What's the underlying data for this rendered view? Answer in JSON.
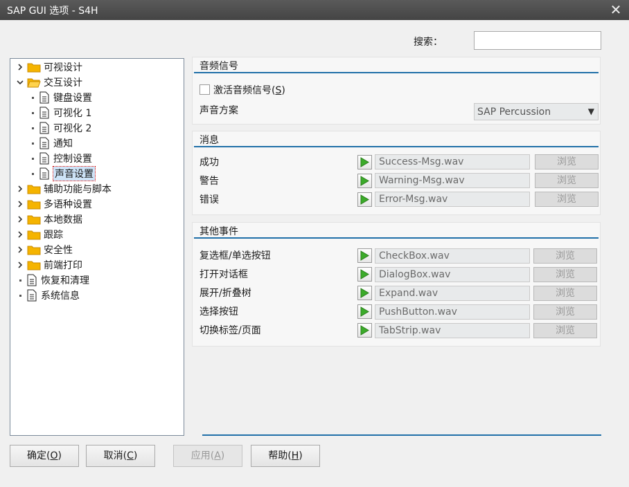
{
  "window": {
    "title": "SAP GUI 选项 - S4H",
    "close_icon": "close-icon"
  },
  "search": {
    "label": "搜索：",
    "value": ""
  },
  "tree": {
    "items": [
      {
        "label": "可视设计",
        "type": "folder",
        "expanded": false
      },
      {
        "label": "交互设计",
        "type": "folder",
        "expanded": true
      },
      {
        "label": "键盘设置",
        "type": "doc"
      },
      {
        "label": "可视化 1",
        "type": "doc"
      },
      {
        "label": "可视化 2",
        "type": "doc"
      },
      {
        "label": "通知",
        "type": "doc"
      },
      {
        "label": "控制设置",
        "type": "doc"
      },
      {
        "label": "声音设置",
        "type": "doc",
        "selected": true
      },
      {
        "label": "辅助功能与脚本",
        "type": "folder",
        "expanded": false
      },
      {
        "label": "多语种设置",
        "type": "folder",
        "expanded": false
      },
      {
        "label": "本地数据",
        "type": "folder",
        "expanded": false
      },
      {
        "label": "跟踪",
        "type": "folder",
        "expanded": false
      },
      {
        "label": "安全性",
        "type": "folder",
        "expanded": false
      },
      {
        "label": "前端打印",
        "type": "folder",
        "expanded": false
      },
      {
        "label": "恢复和清理",
        "type": "doc"
      },
      {
        "label": "系统信息",
        "type": "doc"
      }
    ]
  },
  "audio_signal": {
    "title": "音频信号",
    "activate_label": "激活音频信号",
    "activate_mnemonic": "S",
    "activate_checked": false,
    "scheme_label": "声音方案",
    "scheme_value": "SAP Percussion"
  },
  "messages": {
    "title": "消息",
    "rows": [
      {
        "label": "成功",
        "file": "Success-Msg.wav",
        "browse": "浏览"
      },
      {
        "label": "警告",
        "file": "Warning-Msg.wav",
        "browse": "浏览"
      },
      {
        "label": "错误",
        "file": "Error-Msg.wav",
        "browse": "浏览"
      }
    ]
  },
  "other_events": {
    "title": "其他事件",
    "rows": [
      {
        "label": "复选框/单选按钮",
        "file": "CheckBox.wav",
        "browse": "浏览"
      },
      {
        "label": "打开对话框",
        "file": "DialogBox.wav",
        "browse": "浏览"
      },
      {
        "label": "展开/折叠树",
        "file": "Expand.wav",
        "browse": "浏览"
      },
      {
        "label": "选择按钮",
        "file": "PushButton.wav",
        "browse": "浏览"
      },
      {
        "label": "切换标签/页面",
        "file": "TabStrip.wav",
        "browse": "浏览"
      }
    ]
  },
  "buttons": {
    "ok": {
      "label": "确定",
      "mnemonic": "O"
    },
    "cancel": {
      "label": "取消",
      "mnemonic": "C"
    },
    "apply": {
      "label": "应用",
      "mnemonic": "A",
      "enabled": false
    },
    "help": {
      "label": "帮助",
      "mnemonic": "H"
    }
  },
  "colors": {
    "accent": "#1f6fa8",
    "titlebar": "#4a4a4a",
    "folder": "#f5b400",
    "play": "#3cab2a"
  }
}
